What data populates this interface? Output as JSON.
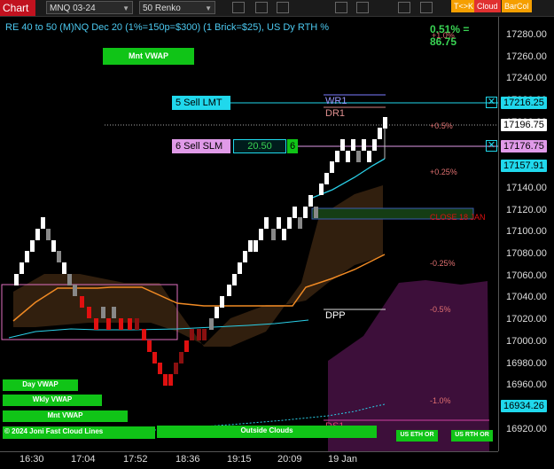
{
  "toolbar": {
    "chart_tab": "Chart",
    "instrument": "MNQ 03-24",
    "bar_type": "50 Renko",
    "icons": [
      "magnifier-icon",
      "brush-icon",
      "text-icon",
      "line-draw-icon",
      "chart-style-icon",
      "cursor-icon",
      "settings-icon"
    ],
    "buttons": [
      {
        "label": "T<>K",
        "color": "#f59f00"
      },
      {
        "label": "Cloud",
        "color": "#e03131"
      },
      {
        "label": "BarCol",
        "color": "#f59f00"
      }
    ]
  },
  "chart": {
    "title": "RE 40 to 50 (M)NQ Dec 20 (1%=150p=$300) (1 Brick=$25), US Dy RTH %",
    "pct_label": "0.51% = 86.75"
  },
  "orders": {
    "sell_lmt": {
      "label": "5 Sell LMT",
      "price": "17216.25"
    },
    "sell_slm": {
      "label": "6 Sell SLM",
      "price": "17176.75",
      "offset": "20.50",
      "qty": "6"
    }
  },
  "last_price": "17196.75",
  "vwap_price": "17157.91",
  "bottom_price": "16934.26",
  "levels": {
    "pivot_labels": [
      "WR1",
      "DR1",
      "DPP",
      "DS1"
    ],
    "pct_labels": [
      "+1.0%",
      "+0.5%",
      "+0.25%",
      "-0.25%",
      "-0.5%",
      "-1.0%"
    ],
    "close_label": "CLOSE 18 JAN"
  },
  "indicator_buttons": {
    "mnt_vwap_top": "Mnt VWAP",
    "day_vwap": "Day VWAP",
    "wkly_vwap": "Wkly VWAP",
    "mnt_vwap": "Mnt VWAP",
    "fast_cloud": "© 2024 Joni Fast Cloud Lines",
    "outside_clouds": "Outside Clouds",
    "us_eth_or": "US ETH OR",
    "us_rth_or": "US RTH OR"
  },
  "price_axis": {
    "ticks": [
      "17280.00",
      "17260.00",
      "17240.00",
      "17220.00",
      "17200.00",
      "17180.00",
      "17160.00",
      "17140.00",
      "17120.00",
      "17100.00",
      "17080.00",
      "17060.00",
      "17040.00",
      "17020.00",
      "17000.00",
      "16980.00",
      "16960.00",
      "16940.00",
      "16920.00"
    ]
  },
  "time_axis": {
    "ticks": [
      "16:30",
      "17:04",
      "17:52",
      "18:36",
      "19:15",
      "20:09",
      "19 Jan"
    ]
  },
  "colors": {
    "up_brick": "#ffffff",
    "down_brick": "#e01010",
    "vwap_cyan": "#2ad0e8",
    "orange": "#f08a24",
    "sell_lmt": "#20d8ec",
    "sell_slm": "#e09ae8",
    "green_btn": "#10c417"
  }
}
